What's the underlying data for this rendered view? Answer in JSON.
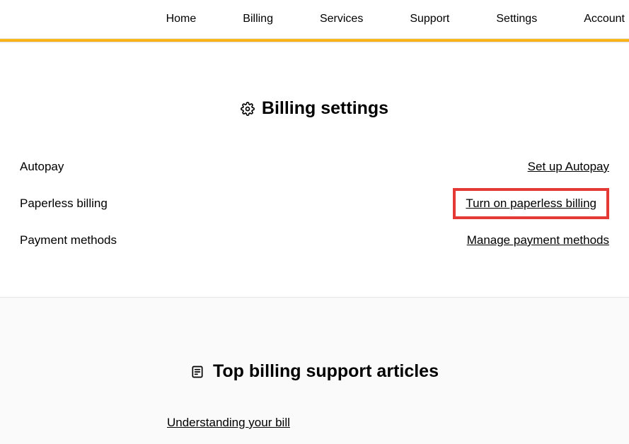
{
  "nav": {
    "items": [
      {
        "label": "Home"
      },
      {
        "label": "Billing"
      },
      {
        "label": "Services"
      },
      {
        "label": "Support"
      },
      {
        "label": "Settings"
      },
      {
        "label": "Account"
      }
    ]
  },
  "billing": {
    "title": "Billing settings",
    "rows": [
      {
        "label": "Autopay",
        "action": "Set up Autopay"
      },
      {
        "label": "Paperless billing",
        "action": "Turn on paperless billing"
      },
      {
        "label": "Payment methods",
        "action": "Manage payment methods"
      }
    ]
  },
  "support": {
    "title": "Top billing support articles",
    "article": "Understanding your bill"
  }
}
